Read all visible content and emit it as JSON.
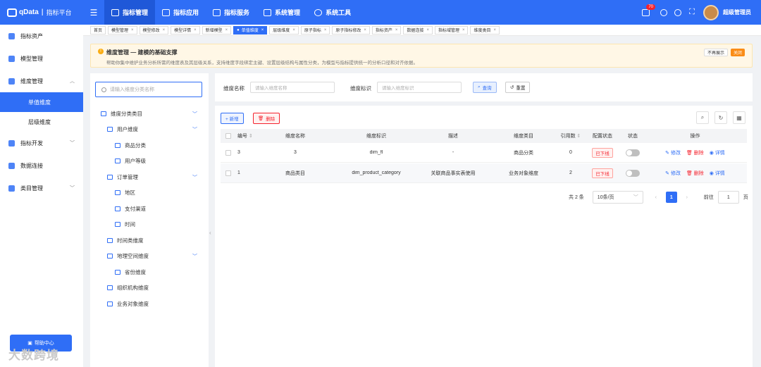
{
  "brand": {
    "name": "qData",
    "subtitle": "指标平台"
  },
  "topnav": [
    {
      "label": "指标管理",
      "active": true
    },
    {
      "label": "指标应用",
      "active": false
    },
    {
      "label": "指标服务",
      "active": false
    },
    {
      "label": "系统管理",
      "active": false
    },
    {
      "label": "系统工具",
      "active": false
    }
  ],
  "header": {
    "notification_count": "70",
    "username": "超级管理员"
  },
  "sidebar": {
    "items": [
      {
        "label": "指标资产"
      },
      {
        "label": "模型管理"
      },
      {
        "label": "维度管理"
      },
      {
        "label": "指标开发"
      },
      {
        "label": "数据连接"
      },
      {
        "label": "类目管理"
      }
    ],
    "subitems": [
      {
        "label": "单值维度",
        "active": true
      },
      {
        "label": "层级维度",
        "active": false
      }
    ],
    "help": "帮助中心",
    "watermark": "大数跨境"
  },
  "tabs": [
    {
      "label": "首页"
    },
    {
      "label": "模型管理"
    },
    {
      "label": "模型修改"
    },
    {
      "label": "模型详情"
    },
    {
      "label": "新增模型"
    },
    {
      "label": "单值维度"
    },
    {
      "label": "层级维度"
    },
    {
      "label": "原子指标"
    },
    {
      "label": "原子指标修改"
    },
    {
      "label": "指标资产"
    },
    {
      "label": "数据连接"
    },
    {
      "label": "指标域管理"
    },
    {
      "label": "维度类目"
    }
  ],
  "notice": {
    "title": "维度管理 — 建模的基础支撑",
    "description": "帮助你集中维护业务分析所需的维度表及其层级关系，支持维度字段绑定主键、设置层级结构与属性分类，为模型与指标提供统一的分析口径和对齐依据。",
    "no_show": "不再展示",
    "close": "关闭"
  },
  "tree": {
    "search_placeholder": "请输入维度分类名称",
    "nodes": [
      {
        "label": "维度分类类目",
        "has_children": true
      },
      {
        "label": "用户维度",
        "has_children": true
      },
      {
        "label": "商品分类",
        "has_children": false
      },
      {
        "label": "用户等级",
        "has_children": false
      },
      {
        "label": "订单管理",
        "has_children": true
      },
      {
        "label": "地区",
        "has_children": false
      },
      {
        "label": "支付渠道",
        "has_children": false
      },
      {
        "label": "时间",
        "has_children": false
      },
      {
        "label": "时间类维度",
        "has_children": false
      },
      {
        "label": "地理空间维度",
        "has_children": true
      },
      {
        "label": "省份维度",
        "has_children": false
      },
      {
        "label": "组织机构维度",
        "has_children": false
      },
      {
        "label": "业务对象维度",
        "has_children": false
      }
    ]
  },
  "filter": {
    "name_label": "维度名称",
    "name_placeholder": "请输入维度名称",
    "key_label": "维度标识",
    "key_placeholder": "请输入维度标识",
    "query": "查询",
    "reset": "重置"
  },
  "toolbar": {
    "add": "+ 新增",
    "delete": "删除"
  },
  "table": {
    "columns": {
      "no": "编号",
      "name": "维度名称",
      "key": "维度标识",
      "desc": "描述",
      "category": "维度类目",
      "refs": "引用数",
      "config": "配置状态",
      "state": "状态",
      "ops": "操作"
    },
    "rows": [
      {
        "no": "3",
        "name": "3",
        "key": "dim_fl",
        "desc": "-",
        "category": "商品分类",
        "refs": "0",
        "config": "已下线"
      },
      {
        "no": "1",
        "name": "商品类目",
        "key": "dim_product_category",
        "desc": "关联商品事实表使用",
        "category": "业务对象维度",
        "refs": "2",
        "config": "已下线"
      }
    ],
    "ops": {
      "edit": "修改",
      "remove": "删除",
      "detail": "详情"
    }
  },
  "pagination": {
    "total": "共 2 条",
    "page_size": "10条/页",
    "current": "1",
    "goto_label": "前往",
    "goto_value": "1",
    "page_unit": "页"
  }
}
